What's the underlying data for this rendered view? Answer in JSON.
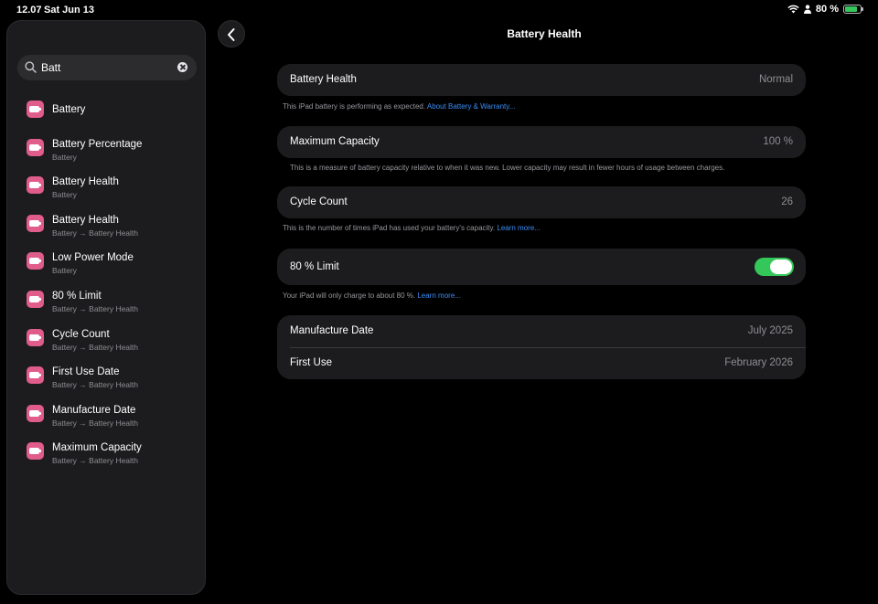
{
  "status_bar": {
    "time": "12.07",
    "date": "Sat Jun 13",
    "battery_percent": "80 %",
    "battery_level": 0.8
  },
  "search": {
    "value": "Batt",
    "placeholder": "Search"
  },
  "results": [
    {
      "title": "Battery",
      "subtitle": ""
    },
    {
      "title": "Battery Percentage",
      "subtitle": "Battery"
    },
    {
      "title": "Battery Health",
      "subtitle": "Battery"
    },
    {
      "title": "Battery Health",
      "subtitle": "Battery → Battery Health"
    },
    {
      "title": "Low Power Mode",
      "subtitle": "Battery"
    },
    {
      "title": "80 % Limit",
      "subtitle": "Battery → Battery Health"
    },
    {
      "title": "Cycle Count",
      "subtitle": "Battery → Battery Health"
    },
    {
      "title": "First Use Date",
      "subtitle": "Battery → Battery Health"
    },
    {
      "title": "Manufacture Date",
      "subtitle": "Battery → Battery Health"
    },
    {
      "title": "Maximum Capacity",
      "subtitle": "Battery → Battery Health"
    }
  ],
  "header": {
    "title": "Battery Health"
  },
  "health": {
    "label": "Battery Health",
    "value": "Normal",
    "note": "This iPad battery is performing as expected. ",
    "note_link": "About Battery & Warranty..."
  },
  "capacity": {
    "label": "Maximum Capacity",
    "value": "100 %",
    "note": "This is a measure of battery capacity relative to when it was new. Lower capacity may result in fewer hours of usage between charges."
  },
  "cycles": {
    "label": "Cycle Count",
    "value": "26",
    "note": "This is the number of times iPad has used your battery's capacity. ",
    "note_link": "Learn more..."
  },
  "limit": {
    "label": "80 % Limit",
    "enabled": true,
    "note": "Your iPad will only charge to about 80 %. ",
    "note_link": "Learn more..."
  },
  "dates": {
    "manufacture_label": "Manufacture Date",
    "manufacture_value": "July 2025",
    "first_use_label": "First Use",
    "first_use_value": "February 2026"
  },
  "colors": {
    "accent_green": "#34c759",
    "link_blue": "#3a8ef6",
    "icon_pink": "#e05c8a"
  }
}
